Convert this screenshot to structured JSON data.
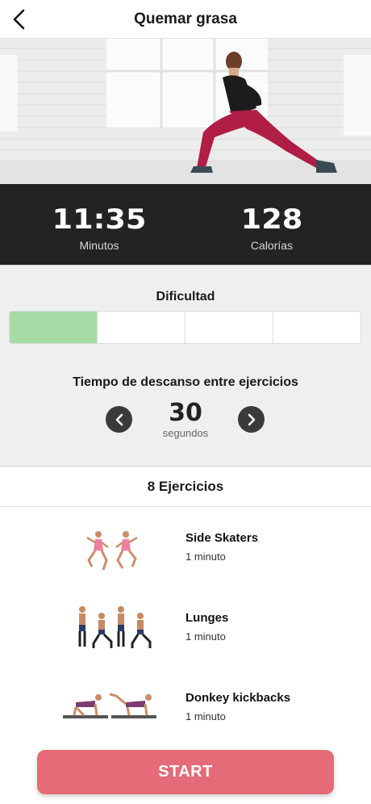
{
  "header": {
    "title": "Quemar grasa",
    "back_icon": "chevron-left-icon"
  },
  "stats": {
    "duration_value": "11:35",
    "duration_label": "Minutos",
    "calories_value": "128",
    "calories_label": "Calorías"
  },
  "difficulty": {
    "title": "Dificultad",
    "level": 1,
    "max_level": 4,
    "active_color": "#a7dba5"
  },
  "rest": {
    "title": "Tiempo de descanso entre ejercicios",
    "value": "30",
    "unit": "segundos",
    "prev_icon": "chevron-left-circle-icon",
    "next_icon": "chevron-right-circle-icon"
  },
  "exercises": {
    "header": "8 Ejercicios",
    "items": [
      {
        "name": "Side Skaters",
        "duration": "1 minuto"
      },
      {
        "name": "Lunges",
        "duration": "1 minuto"
      },
      {
        "name": "Donkey kickbacks",
        "duration": "1 minuto"
      }
    ]
  },
  "start_button": {
    "label": "START",
    "color": "#e56b78"
  },
  "colors": {
    "stats_background": "#232323",
    "settings_background": "#efefef"
  }
}
